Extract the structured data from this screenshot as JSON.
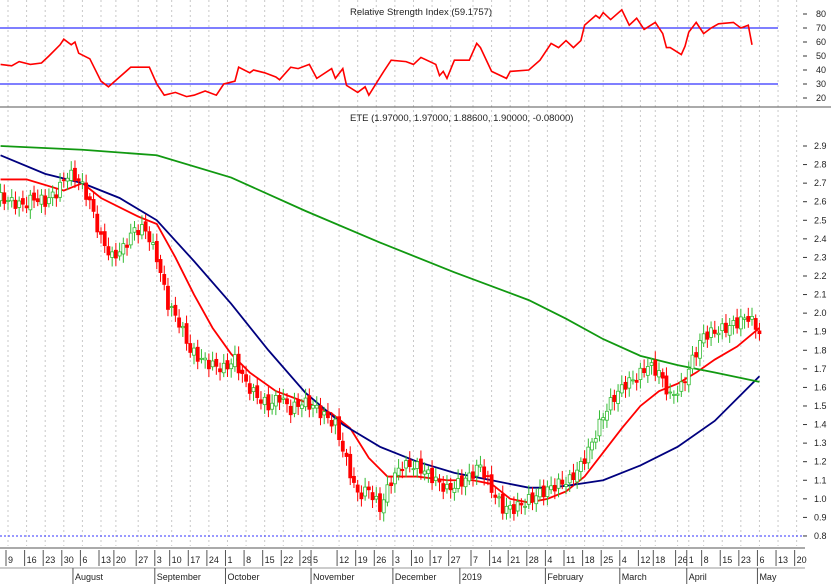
{
  "chart_data": [
    {
      "type": "line",
      "title": "Relative Strength Index (59.1757)",
      "ylim": [
        15,
        85
      ],
      "y_ticks": [
        20,
        30,
        40,
        50,
        60,
        70,
        80
      ],
      "reference_lines": [
        70,
        30
      ],
      "colors": {
        "line": "#ff0000",
        "reference": "#3333ff"
      },
      "series": [
        {
          "name": "RSI",
          "points": [
            [
              -2,
              44
            ],
            [
              1,
              43
            ],
            [
              3,
              46
            ],
            [
              6,
              44
            ],
            [
              9,
              45
            ],
            [
              11,
              50
            ],
            [
              14,
              58
            ],
            [
              15,
              62
            ],
            [
              17,
              58
            ],
            [
              18,
              60
            ],
            [
              19,
              52
            ],
            [
              22,
              48
            ],
            [
              25,
              32
            ],
            [
              27,
              28
            ],
            [
              30,
              35
            ],
            [
              33,
              42
            ],
            [
              37,
              42
            ],
            [
              38,
              42
            ],
            [
              40,
              30
            ],
            [
              42,
              22
            ],
            [
              45,
              24
            ],
            [
              48,
              21
            ],
            [
              50,
              22
            ],
            [
              53,
              25
            ],
            [
              56,
              22
            ],
            [
              58,
              30
            ],
            [
              61,
              32
            ],
            [
              62,
              42
            ],
            [
              65,
              38
            ],
            [
              66,
              40
            ],
            [
              69,
              38
            ],
            [
              72,
              35
            ],
            [
              73,
              33
            ],
            [
              76,
              42
            ],
            [
              78,
              41
            ],
            [
              81,
              44
            ],
            [
              83,
              34
            ],
            [
              87,
              41
            ],
            [
              88,
              34
            ],
            [
              90,
              41
            ],
            [
              91,
              29
            ],
            [
              94,
              24
            ],
            [
              96,
              28
            ],
            [
              97,
              22
            ],
            [
              101,
              39
            ],
            [
              103,
              47
            ],
            [
              107,
              46
            ],
            [
              109,
              44
            ],
            [
              111,
              49
            ],
            [
              115,
              44
            ],
            [
              116,
              36
            ],
            [
              117,
              39
            ],
            [
              118,
              34
            ],
            [
              120,
              47
            ],
            [
              124,
              47
            ],
            [
              126,
              59
            ],
            [
              127,
              56
            ],
            [
              130,
              39
            ],
            [
              134,
              34
            ],
            [
              135,
              39
            ],
            [
              140,
              40
            ],
            [
              143,
              47
            ],
            [
              146,
              59
            ],
            [
              148,
              56
            ],
            [
              150,
              61
            ],
            [
              152,
              56
            ],
            [
              154,
              61
            ],
            [
              155,
              72
            ],
            [
              158,
              79
            ],
            [
              159,
              77
            ],
            [
              160,
              81
            ],
            [
              162,
              76
            ],
            [
              165,
              83
            ],
            [
              167,
              72
            ],
            [
              169,
              77
            ],
            [
              171,
              69
            ],
            [
              174,
              74
            ],
            [
              176,
              66
            ],
            [
              177,
              56
            ],
            [
              178,
              56
            ],
            [
              181,
              51
            ],
            [
              182,
              57
            ],
            [
              183,
              67
            ],
            [
              185,
              74
            ],
            [
              186,
              70
            ],
            [
              187,
              66
            ],
            [
              189,
              70
            ],
            [
              191,
              73
            ],
            [
              195,
              74
            ],
            [
              197,
              70
            ],
            [
              199,
              72
            ],
            [
              200,
              58
            ]
          ]
        }
      ]
    },
    {
      "type": "candlestick",
      "title": "ETE (1.97000, 1.97000, 1.88600, 1.90000, -0.08000)",
      "x_unit": "trading-day index",
      "xlim": [
        -2,
        215
      ],
      "ylim": [
        0.8,
        2.95
      ],
      "y_ticks": [
        0.8,
        0.9,
        1.0,
        1.1,
        1.2,
        1.3,
        1.4,
        1.5,
        1.6,
        1.7,
        1.8,
        1.9,
        2.0,
        2.1,
        2.2,
        2.3,
        2.4,
        2.5,
        2.6,
        2.7,
        2.8,
        2.9
      ],
      "colors": {
        "up": "#33bb33",
        "down": "#ff0000",
        "ma_short": "#ff0000",
        "ma_mid": "#00007f",
        "ma_long": "#119911",
        "floor_line": "#3333ff"
      },
      "close_step": 3,
      "close_start": -2,
      "closes": [
        2.62,
        2.6,
        2.58,
        2.62,
        2.6,
        2.65,
        2.75,
        2.72,
        2.6,
        2.4,
        2.3,
        2.35,
        2.45,
        2.45,
        2.3,
        2.05,
        1.95,
        1.8,
        1.75,
        1.72,
        1.7,
        1.75,
        1.62,
        1.55,
        1.5,
        1.55,
        1.48,
        1.52,
        1.5,
        1.45,
        1.4,
        1.2,
        1.02,
        1.05,
        0.95,
        1.1,
        1.18,
        1.18,
        1.15,
        1.1,
        1.05,
        1.08,
        1.12,
        1.18,
        1.05,
        0.95,
        0.95,
        0.98,
        1.02,
        1.05,
        1.08,
        1.1,
        1.18,
        1.3,
        1.45,
        1.55,
        1.62,
        1.65,
        1.72,
        1.68,
        1.55,
        1.6,
        1.75,
        1.88,
        1.9,
        1.92,
        1.95,
        1.98,
        1.9
      ],
      "moving_averages": [
        {
          "name": "short",
          "points": [
            [
              -2,
              2.72
            ],
            [
              5,
              2.72
            ],
            [
              15,
              2.66
            ],
            [
              20,
              2.7
            ],
            [
              25,
              2.62
            ],
            [
              35,
              2.52
            ],
            [
              40,
              2.48
            ],
            [
              45,
              2.3
            ],
            [
              50,
              2.1
            ],
            [
              55,
              1.92
            ],
            [
              60,
              1.78
            ],
            [
              65,
              1.68
            ],
            [
              72,
              1.58
            ],
            [
              80,
              1.52
            ],
            [
              87,
              1.46
            ],
            [
              92,
              1.38
            ],
            [
              97,
              1.22
            ],
            [
              102,
              1.12
            ],
            [
              110,
              1.12
            ],
            [
              118,
              1.1
            ],
            [
              125,
              1.1
            ],
            [
              130,
              1.08
            ],
            [
              135,
              1.0
            ],
            [
              140,
              0.98
            ],
            [
              145,
              1.0
            ],
            [
              150,
              1.04
            ],
            [
              155,
              1.12
            ],
            [
              160,
              1.25
            ],
            [
              165,
              1.38
            ],
            [
              170,
              1.5
            ],
            [
              175,
              1.58
            ],
            [
              180,
              1.62
            ],
            [
              185,
              1.68
            ],
            [
              190,
              1.75
            ],
            [
              196,
              1.82
            ],
            [
              202,
              1.92
            ]
          ]
        },
        {
          "name": "mid",
          "points": [
            [
              -2,
              2.85
            ],
            [
              10,
              2.75
            ],
            [
              20,
              2.7
            ],
            [
              30,
              2.62
            ],
            [
              40,
              2.5
            ],
            [
              50,
              2.28
            ],
            [
              60,
              2.05
            ],
            [
              70,
              1.8
            ],
            [
              80,
              1.57
            ],
            [
              90,
              1.4
            ],
            [
              100,
              1.28
            ],
            [
              110,
              1.2
            ],
            [
              120,
              1.14
            ],
            [
              130,
              1.1
            ],
            [
              140,
              1.06
            ],
            [
              145,
              1.06
            ],
            [
              150,
              1.07
            ],
            [
              160,
              1.1
            ],
            [
              170,
              1.18
            ],
            [
              180,
              1.28
            ],
            [
              190,
              1.42
            ],
            [
              197,
              1.56
            ],
            [
              202,
              1.66
            ]
          ]
        },
        {
          "name": "long",
          "points": [
            [
              -2,
              2.9
            ],
            [
              20,
              2.88
            ],
            [
              40,
              2.85
            ],
            [
              60,
              2.73
            ],
            [
              80,
              2.55
            ],
            [
              100,
              2.38
            ],
            [
              120,
              2.22
            ],
            [
              140,
              2.07
            ],
            [
              150,
              1.97
            ],
            [
              160,
              1.86
            ],
            [
              170,
              1.77
            ],
            [
              180,
              1.72
            ],
            [
              190,
              1.68
            ],
            [
              202,
              1.63
            ]
          ]
        }
      ],
      "x_ticks": [
        [
          0,
          "9"
        ],
        [
          5,
          "16"
        ],
        [
          10,
          "23"
        ],
        [
          15,
          "30"
        ],
        [
          20,
          "6"
        ],
        [
          25,
          "13"
        ],
        [
          29,
          "20"
        ],
        [
          35,
          "27"
        ],
        [
          40,
          "3"
        ],
        [
          44,
          "10"
        ],
        [
          49,
          "17"
        ],
        [
          54,
          "24"
        ],
        [
          59,
          "1"
        ],
        [
          64,
          "8"
        ],
        [
          69,
          "15"
        ],
        [
          74,
          "22"
        ],
        [
          79,
          "29"
        ],
        [
          82,
          "5"
        ],
        [
          89,
          "12"
        ],
        [
          94,
          "19"
        ],
        [
          99,
          "26"
        ],
        [
          104,
          "3"
        ],
        [
          109,
          "10"
        ],
        [
          114,
          "17"
        ],
        [
          119,
          "27"
        ],
        [
          125,
          "7"
        ],
        [
          130,
          "14"
        ],
        [
          135,
          "21"
        ],
        [
          140,
          "28"
        ],
        [
          145,
          "4"
        ],
        [
          150,
          "11"
        ],
        [
          155,
          "18"
        ],
        [
          160,
          "25"
        ],
        [
          165,
          "4"
        ],
        [
          170,
          "12"
        ],
        [
          174,
          "18"
        ],
        [
          180,
          "26"
        ],
        [
          183,
          "1"
        ],
        [
          187,
          "8"
        ],
        [
          192,
          "15"
        ],
        [
          197,
          "23"
        ],
        [
          202,
          "6"
        ],
        [
          207,
          "13"
        ],
        [
          212,
          "20"
        ]
      ],
      "month_labels": [
        [
          18,
          "August"
        ],
        [
          40,
          "September"
        ],
        [
          59,
          "October"
        ],
        [
          82,
          "November"
        ],
        [
          104,
          "December"
        ],
        [
          122,
          "2019"
        ],
        [
          145,
          "February"
        ],
        [
          165,
          "March"
        ],
        [
          183,
          "April"
        ],
        [
          202,
          "May"
        ]
      ]
    }
  ]
}
